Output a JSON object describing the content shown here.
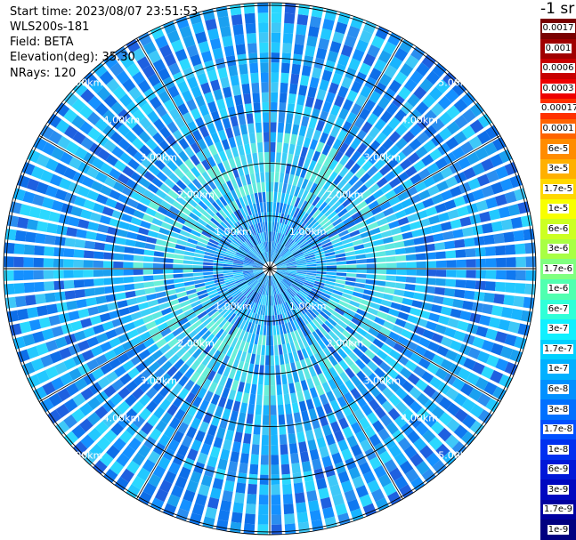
{
  "header": {
    "start_time": "Start time: 2023/08/07 23:51:53",
    "instrument": "WLS200s-181",
    "field": "Field: BETA",
    "elevation": "Elevation(deg): 35.30",
    "nrays": "NRays: 120"
  },
  "units": "-1 sr",
  "range_rings": {
    "labels": [
      "1.00km",
      "2.00km",
      "3.00km",
      "4.00km",
      "5.00km"
    ],
    "values_km": [
      1,
      2,
      3,
      4,
      5
    ]
  },
  "colorbar": {
    "labels": [
      "0.0017",
      "0.001",
      "0.0006",
      "0.0003",
      "0.00017",
      "0.0001",
      "6e-5",
      "3e-5",
      "1.7e-5",
      "1e-5",
      "6e-6",
      "3e-6",
      "1.7e-6",
      "1e-6",
      "6e-7",
      "3e-7",
      "1.7e-7",
      "1e-7",
      "6e-8",
      "3e-8",
      "1.7e-8",
      "1e-8",
      "6e-9",
      "3e-9",
      "1.7e-9",
      "1e-9"
    ],
    "colors": [
      "#7a0000",
      "#a00000",
      "#c80000",
      "#ee0000",
      "#ff3000",
      "#ff6400",
      "#ff8c00",
      "#ffb000",
      "#ffd800",
      "#f8ff00",
      "#ccff22",
      "#a8ff44",
      "#80ff80",
      "#50ffb0",
      "#30ffd8",
      "#10f0ff",
      "#00d0ff",
      "#00b0ff",
      "#0090ff",
      "#0070ff",
      "#0050ff",
      "#0030f0",
      "#0018d8",
      "#0008c0",
      "#0000a0",
      "#000080"
    ]
  }
}
